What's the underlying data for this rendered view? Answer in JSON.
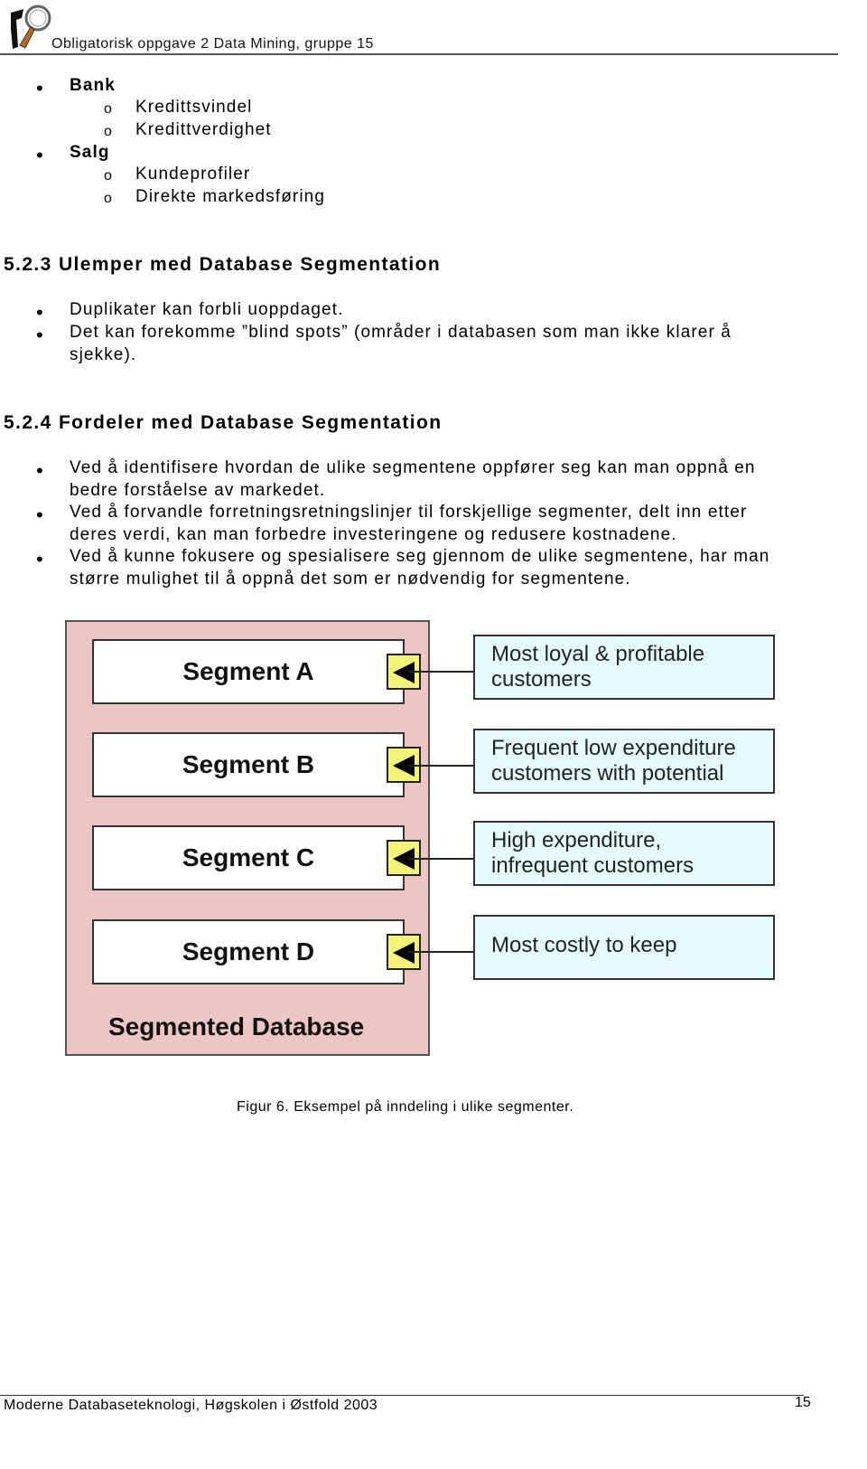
{
  "header": {
    "title": "Obligatorisk oppgave 2 Data Mining, gruppe 15",
    "logo_icon": "magnifier-figure-logo"
  },
  "applications_list": [
    {
      "label": "Bank",
      "subitems": [
        "Kredittsvindel",
        "Kredittverdighet"
      ]
    },
    {
      "label": "Salg",
      "subitems": [
        "Kundeprofiler",
        "Direkte markedsføring"
      ]
    }
  ],
  "section_disadvantages": {
    "heading": "5.2.3 Ulemper med Database Segmentation",
    "items": [
      [
        "Duplikater kan forbli uoppdaget."
      ],
      [
        "Det kan forekomme ”blind spots” (områder i databasen som man ikke klarer å",
        "sjekke)."
      ]
    ]
  },
  "section_advantages": {
    "heading": "5.2.4 Fordeler med Database Segmentation",
    "items": [
      [
        "Ved å identifisere hvordan de ulike segmentene oppfører seg kan man oppnå en",
        "bedre forståelse av markedet."
      ],
      [
        "Ved å forvandle forretningsretningslinjer til forskjellige segmenter, delt inn etter",
        "deres verdi, kan man forbedre investeringene og redusere kostnadene."
      ],
      [
        "Ved å kunne fokusere og spesialisere seg gjennom de ulike segmentene, har man",
        "større mulighet til å oppnå det som er nødvendig for segmentene."
      ]
    ]
  },
  "figure": {
    "database_label": "Segmented Database",
    "segments": [
      {
        "name": "Segment A",
        "description": [
          "Most loyal & profitable",
          "customers"
        ]
      },
      {
        "name": "Segment B",
        "description": [
          "Frequent low expenditure",
          "customers with potential"
        ]
      },
      {
        "name": "Segment C",
        "description": [
          "High expenditure,",
          "infrequent customers"
        ]
      },
      {
        "name": "Segment D",
        "description": [
          "Most costly to keep"
        ]
      }
    ],
    "colors": {
      "database_fill": "#ebc6c5",
      "marker_fill": "#f3f37a",
      "description_fill": "#e6fbfe"
    },
    "caption": "Figur 6. Eksempel på inndeling i ulike segmenter."
  },
  "footer": {
    "text": "Moderne Databaseteknologi, Høgskolen i Østfold 2003",
    "page_number": "15"
  }
}
